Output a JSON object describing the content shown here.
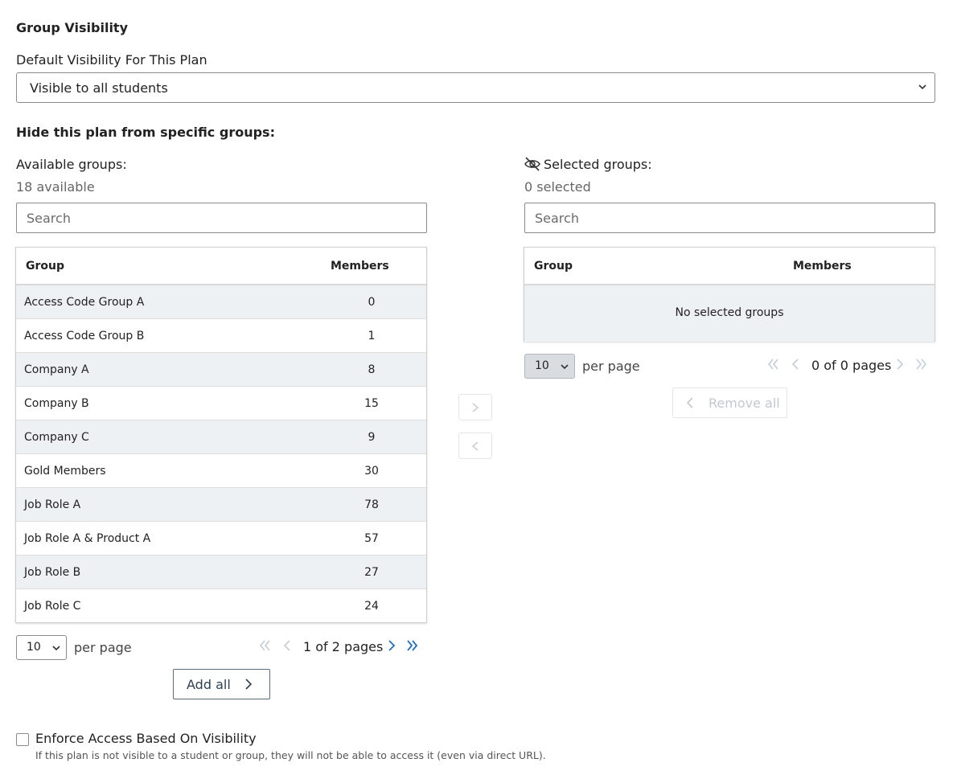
{
  "section_title": "Group Visibility",
  "default_visibility": {
    "label": "Default Visibility For This Plan",
    "selected": "Visible to all students"
  },
  "hide_title": "Hide this plan from specific groups:",
  "available": {
    "label": "Available groups:",
    "count": "18 available",
    "search_placeholder": "Search",
    "col_group": "Group",
    "col_members": "Members",
    "rows": [
      {
        "name": "Access Code Group A",
        "members": "0"
      },
      {
        "name": "Access Code Group B",
        "members": "1"
      },
      {
        "name": "Company A",
        "members": "8"
      },
      {
        "name": "Company B",
        "members": "15"
      },
      {
        "name": "Company C",
        "members": "9"
      },
      {
        "name": "Gold Members",
        "members": "30"
      },
      {
        "name": "Job Role A",
        "members": "78"
      },
      {
        "name": "Job Role A & Product A",
        "members": "57"
      },
      {
        "name": "Job Role B",
        "members": "27"
      },
      {
        "name": "Job Role C",
        "members": "24"
      }
    ],
    "per_page_value": "10",
    "per_page_label": "per page",
    "page_status": "1 of 2 pages",
    "add_all_label": "Add all"
  },
  "selected": {
    "label": "Selected groups:",
    "count": "0 selected",
    "search_placeholder": "Search",
    "col_group": "Group",
    "col_members": "Members",
    "empty_message": "No selected groups",
    "per_page_value": "10",
    "per_page_label": "per page",
    "page_status": "0 of 0 pages",
    "remove_all_label": "Remove all"
  },
  "enforce": {
    "label": "Enforce Access Based On Visibility",
    "help": "If this plan is not visible to a student or group, they will not be able to access it (even via direct URL).",
    "checked": false
  },
  "colors": {
    "accent": "#1f6fbf",
    "disabled_icon": "#c3cdd8",
    "row_stripe": "#eef1f4"
  },
  "icons": {
    "selected_groups": "eye-slash-icon",
    "pager_first": "double-chevron-left-icon",
    "pager_prev": "chevron-left-icon",
    "pager_next": "chevron-right-icon",
    "pager_last": "double-chevron-right-icon"
  }
}
